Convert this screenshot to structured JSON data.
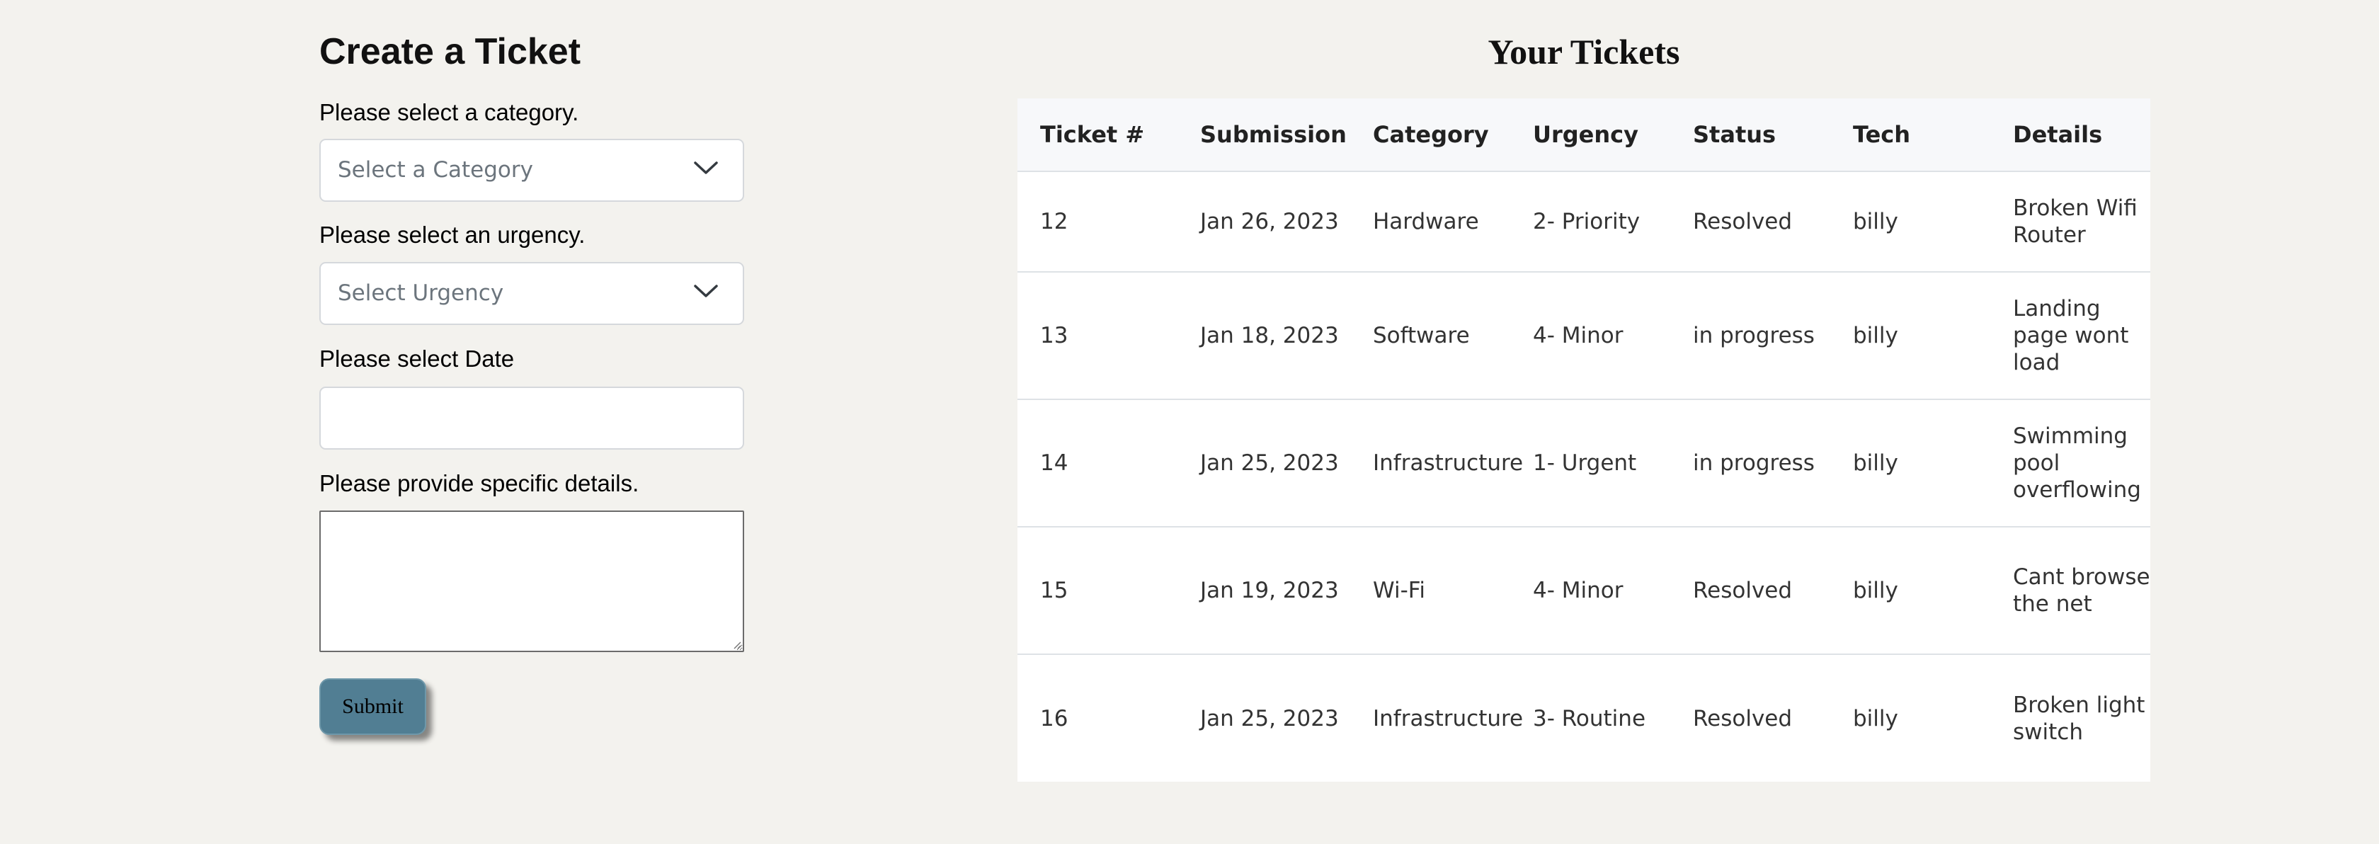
{
  "form": {
    "title": "Create a Ticket",
    "category_label": "Please select a category.",
    "category_placeholder": "Select a Category",
    "urgency_label": "Please select an urgency.",
    "urgency_placeholder": "Select Urgency",
    "date_label": "Please select Date",
    "date_value": "",
    "details_label": "Please provide specific details.",
    "details_value": "",
    "submit_label": "Submit",
    "submit_color": "#517e93"
  },
  "tickets": {
    "title": "Your Tickets",
    "columns": [
      "Ticket #",
      "Submission",
      "Category",
      "Urgency",
      "Status",
      "Tech",
      "Details"
    ],
    "rows": [
      {
        "ticket": "12",
        "submission": "Jan 26, 2023",
        "category": "Hardware",
        "urgency": "2- Priority",
        "status": "Resolved",
        "tech": "billy",
        "details": "Broken Wifi Router"
      },
      {
        "ticket": "13",
        "submission": "Jan 18, 2023",
        "category": "Software",
        "urgency": "4- Minor",
        "status": "in progress",
        "tech": "billy",
        "details": "Landing page wont load"
      },
      {
        "ticket": "14",
        "submission": "Jan 25, 2023",
        "category": "Infrastructure",
        "urgency": "1- Urgent",
        "status": "in progress",
        "tech": "billy",
        "details": "Swimming pool overflowing"
      },
      {
        "ticket": "15",
        "submission": "Jan 19, 2023",
        "category": "Wi-Fi",
        "urgency": "4- Minor",
        "status": "Resolved",
        "tech": "billy",
        "details": "Cant browse the net"
      },
      {
        "ticket": "16",
        "submission": "Jan 25, 2023",
        "category": "Infrastructure",
        "urgency": "3- Routine",
        "status": "Resolved",
        "tech": "billy",
        "details": "Broken light switch"
      }
    ]
  },
  "icons": {
    "category_dropdown": "chevron-down-icon",
    "urgency_dropdown": "chevron-down-icon",
    "textarea_resize": "resize-grip-icon"
  }
}
